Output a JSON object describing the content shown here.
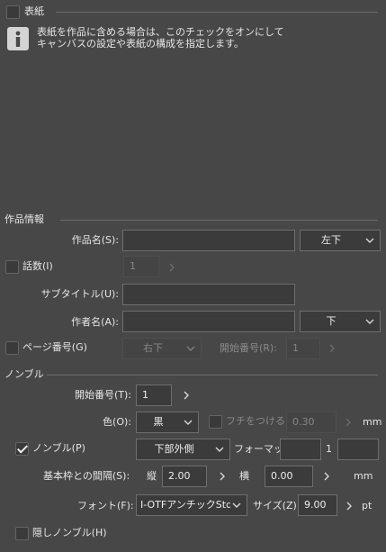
{
  "cover": {
    "label": "表紙",
    "info_line1": "表紙を作品に含める場合は、このチェックをオンにして",
    "info_line2": "キャンバスの設定や表紙の構成を指定します。",
    "info_icon": "info-icon"
  },
  "work_info": {
    "section_title": "作品情報",
    "title_label": "作品名(S):",
    "title_value": "",
    "title_position": "左下",
    "episode_label": "話数(I)",
    "episode_value": "1",
    "subtitle_label": "サブタイトル(U):",
    "subtitle_value": "",
    "author_label": "作者名(A):",
    "author_value": "",
    "author_position": "下",
    "page_number_label": "ページ番号(G)",
    "page_number_position": "右下",
    "start_number_label": "開始番号(R):",
    "start_number_value": "1"
  },
  "nombre": {
    "section_title": "ノンブル",
    "start_label": "開始番号(T):",
    "start_value": "1",
    "color_label": "色(O):",
    "color_value": "黒",
    "border_label": "フチをつける(E)",
    "border_value": "0.30",
    "border_unit": "mm",
    "nombre_label": "ノンブル(P)",
    "nombre_checked": true,
    "position_value": "下部外側",
    "format_label": "フォーマット:",
    "format_prefix": "",
    "format_number": "1",
    "format_suffix": "",
    "distance_label": "基本枠との間隔(S):",
    "vertical_label": "縦",
    "vertical_value": "2.00",
    "horizontal_label": "横",
    "horizontal_value": "0.00",
    "distance_unit": "mm",
    "font_label": "フォント(F):",
    "font_value": "I-OTFアンチックStd B",
    "size_label": "サイズ(Z):",
    "size_value": "9.00",
    "size_unit": "pt",
    "hidden_label": "隠しノンブル(H)"
  },
  "colors": {
    "background": "#474747",
    "field": "#3b3b3b",
    "border": "#6e6e6e",
    "text": "#e6e6e6",
    "disabled_text": "#868686"
  }
}
